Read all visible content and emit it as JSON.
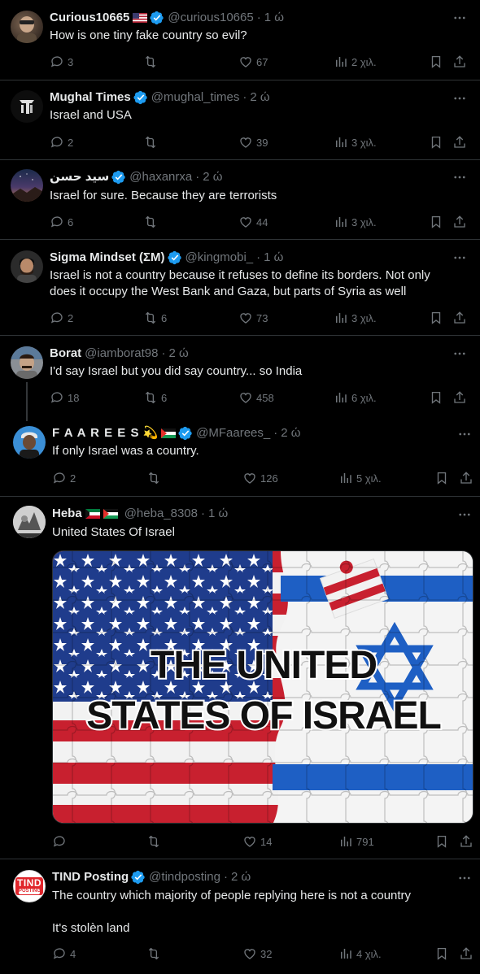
{
  "tweets": [
    {
      "name": "Curious10665",
      "handle": "@curious10665",
      "time": "1 ώ",
      "text": "How is one tiny fake country so evil?",
      "replies": "3",
      "reposts": "",
      "likes": "67",
      "views": "2 χιλ."
    },
    {
      "name": "Mughal Times",
      "handle": "@mughal_times",
      "time": "2 ώ",
      "text": "Israel and USA",
      "replies": "2",
      "reposts": "",
      "likes": "39",
      "views": "3 χιλ."
    },
    {
      "name": "سيد حسن",
      "handle": "@haxanrxa",
      "time": "2 ώ",
      "text": "Israel for sure. Because they are terrorists",
      "replies": "6",
      "reposts": "",
      "likes": "44",
      "views": "3 χιλ."
    },
    {
      "name": "Sigma Mindset (ΣM)",
      "handle": "@kingmobi_",
      "time": "1 ώ",
      "text1": "Israel is not a country because it refuses to define its borders. Not only",
      "text2": "does it occupy the West Bank and Gaza, but parts of Syria as well",
      "replies": "2",
      "reposts": "6",
      "likes": "73",
      "views": "3 χιλ."
    },
    {
      "name": "Borat",
      "handle": "@iamborat98",
      "time": "2 ώ",
      "text": "I'd say Israel but you did say country... so India",
      "replies": "18",
      "reposts": "6",
      "likes": "458",
      "views": "6 χιλ."
    },
    {
      "name": "F A A R E E S",
      "handle": "@MFaarees_",
      "time": "2 ώ",
      "text": "If only Israel was a country.",
      "replies": "2",
      "reposts": "",
      "likes": "126",
      "views": "5 χιλ."
    },
    {
      "name": "Heba",
      "handle": "@heba_8308",
      "time": "1 ώ",
      "text": "United States Of Israel",
      "image_line1": "THE UNITED",
      "image_line2": "STATES OF ISRAEL",
      "replies": "",
      "reposts": "",
      "likes": "14",
      "views": "791"
    },
    {
      "name": "TIND Posting",
      "handle": "@tindposting",
      "time": "2 ώ",
      "text1": "The country which majority of people replying here is not a country",
      "text2": "It's stolèn land",
      "avatar_top": "TIND",
      "avatar_bottom": "POSTING",
      "replies": "4",
      "reposts": "",
      "likes": "32",
      "views": "4 χιλ."
    }
  ],
  "colors": {
    "verified": "#1d9bf0",
    "muted": "#71767b",
    "border": "#2f3336",
    "text": "#e7e9ea",
    "tind_red": "#e0252b"
  }
}
